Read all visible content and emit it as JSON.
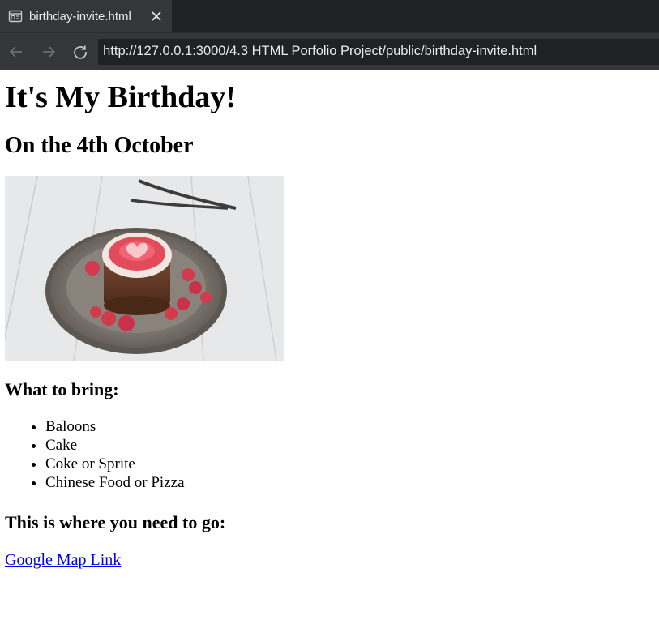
{
  "browser": {
    "tab_title": "birthday-invite.html",
    "url": "http://127.0.0.1:3000/4.3 HTML Porfolio Project/public/birthday-invite.html",
    "tab_icon": "page-icon",
    "colors": {
      "tabbar": "#202124",
      "toolbar": "#35363a",
      "text": "#e8eaed"
    }
  },
  "page": {
    "title": "It's My Birthday!",
    "date": "On the 4th October",
    "image_icon": "cake-photo",
    "bring_heading": "What to bring:",
    "bring_items": [
      "Baloons",
      "Cake",
      "Coke or Sprite",
      "Chinese Food or Pizza"
    ],
    "where_heading": "This is where you need to go:",
    "map_link": "Google Map Link",
    "link_color": "#0000ee"
  }
}
